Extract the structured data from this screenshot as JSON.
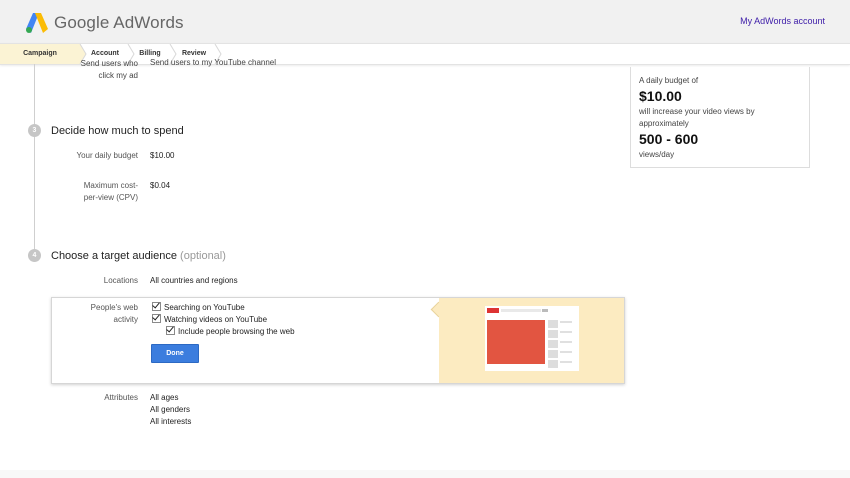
{
  "header": {
    "logo_text": "Google AdWords",
    "account_link": "My AdWords account",
    "colors": {
      "logo_blue": "#4285f4",
      "logo_yellow": "#fbbc05",
      "logo_green": "#34a853"
    }
  },
  "steps": [
    {
      "label": "Campaign",
      "active": true
    },
    {
      "label": "Account",
      "active": false
    },
    {
      "label": "Billing",
      "active": false
    },
    {
      "label": "Review",
      "active": false
    }
  ],
  "partial_row": {
    "label_lines": [
      "Send users who",
      "click my ad"
    ],
    "value": "Send users to my YouTube channel"
  },
  "budget_section": {
    "number": "3",
    "title": "Decide how much to spend",
    "daily_budget_label": "Your daily budget",
    "daily_budget_value": "$10.00",
    "max_cpv_label_line1": "Maximum cost-",
    "max_cpv_label_line2": "per-view (CPV)",
    "max_cpv_value": "$0.04"
  },
  "estimate": {
    "intro": "A daily budget of",
    "budget": "$10.00",
    "line1": "will increase your video views by",
    "line2": "approximately",
    "range": "500 - 600",
    "unit": "views/day"
  },
  "audience_section": {
    "number": "4",
    "title": "Choose a target audience",
    "optional": "(optional)",
    "locations_label": "Locations",
    "locations_value": "All countries and regions",
    "people_label_line1": "People's web",
    "people_label_line2": "activity",
    "options": [
      {
        "label": "Searching on YouTube",
        "checked": true
      },
      {
        "label": "Watching videos on YouTube",
        "checked": true
      },
      {
        "label": "Include people browsing the web",
        "checked": true
      }
    ],
    "done_button": "Done",
    "attributes_label": "Attributes",
    "attributes_values": [
      "All ages",
      "All genders",
      "All interests"
    ]
  }
}
